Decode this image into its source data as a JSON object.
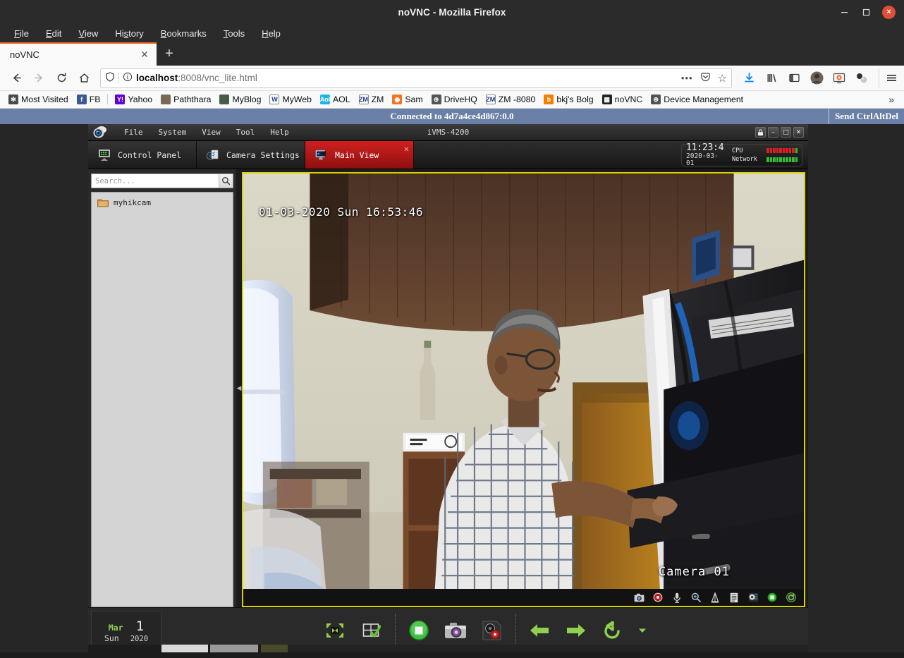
{
  "browser": {
    "window_title": "noVNC - Mozilla Firefox",
    "window_controls": {
      "minimize": "minimize-icon",
      "maximize": "maximize-icon",
      "close": "×"
    },
    "menus": [
      {
        "label": "File",
        "accel": "F"
      },
      {
        "label": "Edit",
        "accel": "E"
      },
      {
        "label": "View",
        "accel": "V"
      },
      {
        "label": "History",
        "accel": "s"
      },
      {
        "label": "Bookmarks",
        "accel": "B"
      },
      {
        "label": "Tools",
        "accel": "T"
      },
      {
        "label": "Help",
        "accel": "H"
      }
    ],
    "tab": {
      "title": "noVNC",
      "close": "✕",
      "new_tab": "+"
    },
    "nav": {
      "back": "back-icon",
      "forward": "forward-icon",
      "reload": "reload-icon",
      "home": "home-icon",
      "shield": "shield-icon",
      "info": "info-icon",
      "url_host": "localhost",
      "url_rest": ":8008/vnc_lite.html",
      "url_full": "localhost:8008/vnc_lite.html",
      "page_actions": "•••",
      "pocket": "pocket-icon",
      "bookmark_star": "☆"
    },
    "toolbar_right": [
      "downloads-icon",
      "library-icon",
      "sidebar-icon",
      "account-avatar",
      "screenshare-icon",
      "extension-icon",
      "hamburger-menu-icon"
    ],
    "bookmarks": [
      {
        "label": "Most Visited",
        "icon": "gear-icon",
        "color": "#4a4a4a",
        "text": "✻"
      },
      {
        "label": "FB",
        "icon": "facebook-icon",
        "color": "#3b5998",
        "text": "f"
      },
      {
        "label": "",
        "icon": "separator",
        "sep": true
      },
      {
        "label": "Yahoo",
        "icon": "yahoo-icon",
        "color": "#6001d2",
        "text": "Y!"
      },
      {
        "label": "Paththara",
        "icon": "photo-icon",
        "color": "#7a6a55",
        "text": ""
      },
      {
        "label": "MyBlog",
        "icon": "landscape-icon",
        "color": "#4a5a4a",
        "text": ""
      },
      {
        "label": "MyWeb",
        "icon": "weebly-icon",
        "color": "#ffffff",
        "text": "W",
        "dark": true
      },
      {
        "label": "AOL",
        "icon": "aol-icon",
        "color": "#1db4e6",
        "text": "Aol"
      },
      {
        "label": "ZM",
        "icon": "zoneminder-icon",
        "color": "#ffffff",
        "text": "ZM",
        "dark": true
      },
      {
        "label": "Sam",
        "icon": "flame-icon",
        "color": "#f27421",
        "text": "◉"
      },
      {
        "label": "DriveHQ",
        "icon": "globe-icon",
        "color": "#555555",
        "text": "⊕"
      },
      {
        "label": "ZM -8080",
        "icon": "zoneminder-icon",
        "color": "#ffffff",
        "text": "ZM",
        "dark": true
      },
      {
        "label": "bkj's Bolg",
        "icon": "blogger-icon",
        "color": "#f57d00",
        "text": "b"
      },
      {
        "label": "noVNC",
        "icon": "novnc-icon",
        "color": "#1d2a1d",
        "text": "▦"
      },
      {
        "label": "Device Management",
        "icon": "globe-icon",
        "color": "#555555",
        "text": "⊕"
      }
    ],
    "bookmarks_overflow": "»"
  },
  "vnc": {
    "status_text": "Connected to 4d7a4ce4d867:0.0",
    "send_cad_label": "Send CtrlAltDel"
  },
  "ivms": {
    "app_name": "iVMS-4200",
    "logo": "camera-logo-icon",
    "menus": [
      "File",
      "System",
      "View",
      "Tool",
      "Help"
    ],
    "window_controls": {
      "lock": "🔒",
      "minimize": "–",
      "maximize": "□",
      "close": "✕"
    },
    "tabs": [
      {
        "label": "Control Panel",
        "icon": "control-panel-icon",
        "active": false,
        "closable": false
      },
      {
        "label": "Camera Settings",
        "icon": "camera-settings-icon",
        "active": false,
        "closable": false
      },
      {
        "label": "Main View",
        "icon": "main-view-icon",
        "active": true,
        "closable": true,
        "close": "✕"
      }
    ],
    "sysinfo": {
      "time": "11:23:4",
      "date": "2020-03-01",
      "cpu_label": "CPU",
      "network_label": "Network",
      "cpu_bars": 10,
      "network_bars": 10,
      "cpu_color": "#e02020",
      "network_color": "#2fbf2f"
    },
    "sidebar": {
      "search_placeholder": "Search...",
      "search_icon": "magnifier-icon",
      "devices": [
        {
          "label": "myhikcam",
          "icon": "folder-icon"
        }
      ],
      "collapse_handle": "◀"
    },
    "video": {
      "osd_timestamp": "01-03-2020 Sun 16:53:46",
      "osd_camera_name": "Camera 01",
      "border_color": "#d8d400",
      "pane_toolbar": [
        {
          "name": "capture-picture-icon",
          "glyph": "📷"
        },
        {
          "name": "record-icon",
          "glyph": "◉"
        },
        {
          "name": "audio-microphone-icon",
          "glyph": "🎙"
        },
        {
          "name": "digital-zoom-icon",
          "glyph": "🔍"
        },
        {
          "name": "ptz-icon",
          "glyph": "△"
        },
        {
          "name": "event-list-icon",
          "glyph": "☰"
        },
        {
          "name": "instant-playback-icon",
          "glyph": "◑"
        },
        {
          "name": "stop-live-view-icon",
          "glyph": "■"
        },
        {
          "name": "refresh-icon",
          "glyph": "↻"
        }
      ]
    },
    "bottom_bar": {
      "calendar": {
        "month": "Mar",
        "day": "1",
        "weekday": "Sun",
        "year": "2020"
      },
      "controls": [
        {
          "name": "fullscreen-button",
          "glyph": "⬚",
          "color": "#8fd14f"
        },
        {
          "name": "layout-select-button",
          "glyph": "⊞",
          "color": "#cccccc"
        },
        {
          "name": "stop-all-live-view-button",
          "glyph": "■",
          "color": "#3fbf3f"
        },
        {
          "name": "capture-all-button",
          "glyph": "📷",
          "color": "#c8c8c8"
        },
        {
          "name": "record-all-button",
          "glyph": "◉",
          "color": "#d03030"
        },
        {
          "name": "previous-page-button",
          "glyph": "←",
          "color": "#8fd14f"
        },
        {
          "name": "next-page-button",
          "glyph": "→",
          "color": "#8fd14f"
        },
        {
          "name": "auto-switch-button",
          "glyph": "↺",
          "color": "#8fd14f"
        },
        {
          "name": "auto-switch-dropdown",
          "glyph": "▾",
          "color": "#8fd14f"
        }
      ]
    }
  }
}
